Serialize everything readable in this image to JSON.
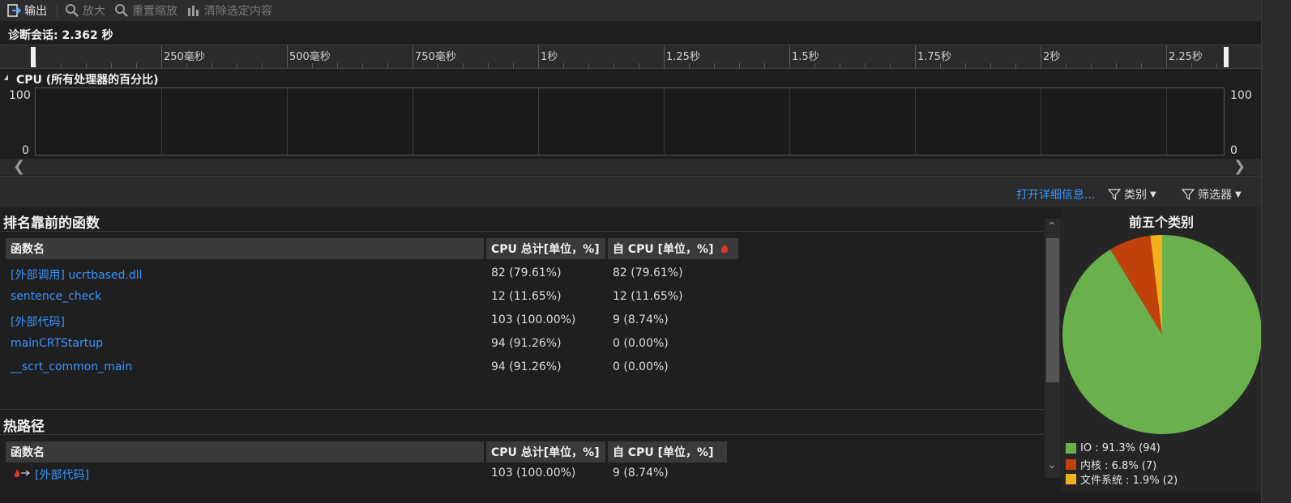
{
  "toolbar": {
    "output": "输出",
    "zoom_in": "放大",
    "reset_zoom": "重置缩放",
    "clear_selection": "清除选定内容"
  },
  "session": {
    "label": "诊断会话: 2.362 秒"
  },
  "ruler": {
    "ticks": [
      "250毫秒",
      "500毫秒",
      "750毫秒",
      "1秒",
      "1.25秒",
      "1.5秒",
      "1.75秒",
      "2秒",
      "2.25秒"
    ]
  },
  "cpu_graph": {
    "title": "CPU (所有处理器的百分比)",
    "y_max": "100",
    "y_min": "0"
  },
  "commands": {
    "open_details": "打开详细信息...",
    "categories": "类别",
    "filter": "筛选器"
  },
  "top_functions": {
    "title": "排名靠前的函数",
    "columns": [
      "函数名",
      "CPU 总计[单位，%]",
      "自 CPU [单位，%]"
    ],
    "rows": [
      {
        "name": "[外部调用] ucrtbased.dll",
        "total": "82 (79.61%)",
        "self": "82 (79.61%)"
      },
      {
        "name": "sentence_check",
        "total": "12 (11.65%)",
        "self": "12 (11.65%)"
      },
      {
        "name": "[外部代码]",
        "total": "103 (100.00%)",
        "self": "9 (8.74%)"
      },
      {
        "name": "mainCRTStartup",
        "total": "94 (91.26%)",
        "self": "0 (0.00%)"
      },
      {
        "name": "__scrt_common_main",
        "total": "94 (91.26%)",
        "self": "0 (0.00%)"
      }
    ]
  },
  "hot_path": {
    "title": "热路径",
    "columns": [
      "函数名",
      "CPU 总计[单位，%]",
      "自 CPU [单位，%]"
    ],
    "rows": [
      {
        "name": "[外部代码]",
        "total": "103 (100.00%)",
        "self": "9 (8.74%)"
      }
    ]
  },
  "top_categories": {
    "title": "前五个类别",
    "items": [
      {
        "label": "IO : 91.3% (94)",
        "value": 91.3,
        "color": "#6ab04c"
      },
      {
        "label": "内核 : 6.8% (7)",
        "value": 6.8,
        "color": "#c0410c"
      },
      {
        "label": "文件系统 : 1.9% (2)",
        "value": 1.9,
        "color": "#f2b01e"
      }
    ]
  }
}
